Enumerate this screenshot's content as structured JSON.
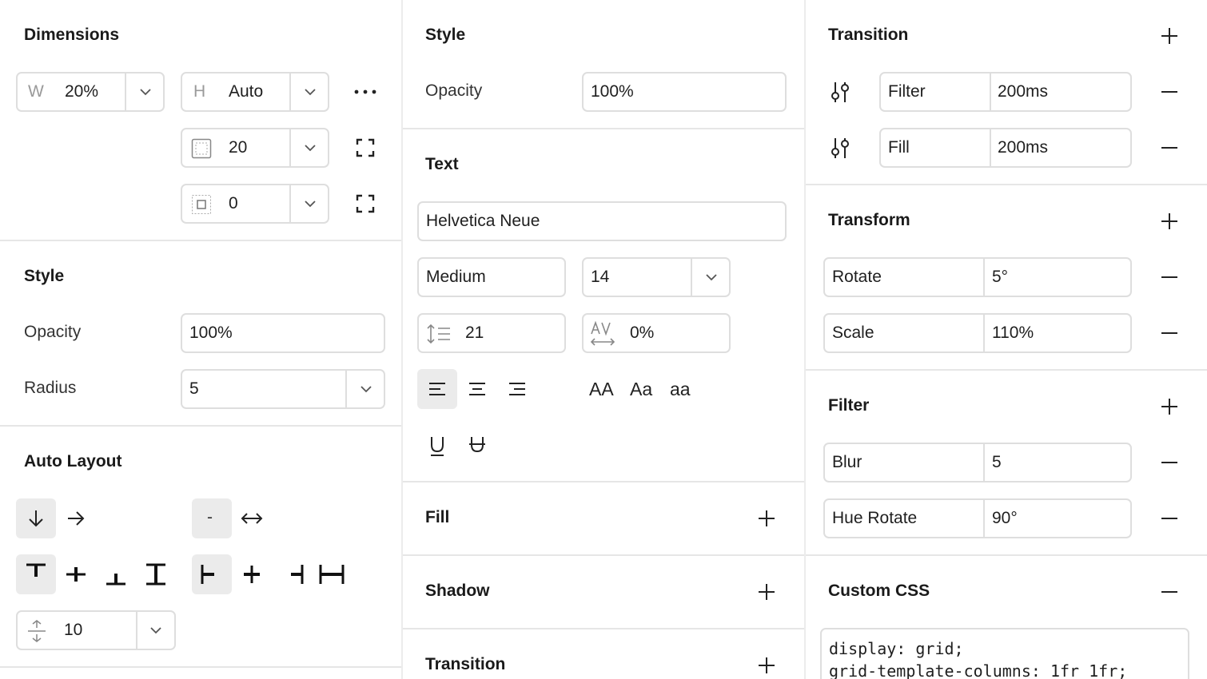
{
  "dimensions": {
    "title": "Dimensions",
    "width": {
      "prefix": "W",
      "value": "20%"
    },
    "height": {
      "prefix": "H",
      "value": "Auto"
    },
    "padding_value": "20",
    "margin_value": "0"
  },
  "style_left": {
    "title": "Style",
    "opacity_label": "Opacity",
    "opacity_value": "100%",
    "radius_label": "Radius",
    "radius_value": "5"
  },
  "auto_layout": {
    "title": "Auto Layout",
    "gap_dash": "-",
    "gap_value": "10"
  },
  "style_mid": {
    "title": "Style",
    "opacity_label": "Opacity",
    "opacity_value": "100%"
  },
  "text": {
    "title": "Text",
    "font_family": "Helvetica Neue",
    "font_weight": "Medium",
    "font_size": "14",
    "line_height": "21",
    "letter_spacing": "0%",
    "case_upper": "AA",
    "case_title": "Aa",
    "case_lower": "aa"
  },
  "fill": {
    "title": "Fill"
  },
  "shadow": {
    "title": "Shadow"
  },
  "transition_mid": {
    "title": "Transition"
  },
  "transition": {
    "title": "Transition",
    "rows": [
      {
        "property": "Filter",
        "duration": "200ms"
      },
      {
        "property": "Fill",
        "duration": "200ms"
      }
    ]
  },
  "transform": {
    "title": "Transform",
    "rows": [
      {
        "property": "Rotate",
        "value": "5°"
      },
      {
        "property": "Scale",
        "value": "110%"
      }
    ]
  },
  "filter": {
    "title": "Filter",
    "rows": [
      {
        "property": "Blur",
        "value": "5"
      },
      {
        "property": "Hue Rotate",
        "value": "90°"
      }
    ]
  },
  "custom_css": {
    "title": "Custom CSS",
    "line1": "display: grid;",
    "line2": "grid-template-columns: 1fr 1fr;"
  },
  "colors": {
    "border": "#dedede",
    "active_bg": "#ebebeb",
    "divider": "#e6e6e6",
    "text": "#1f1f1f"
  }
}
